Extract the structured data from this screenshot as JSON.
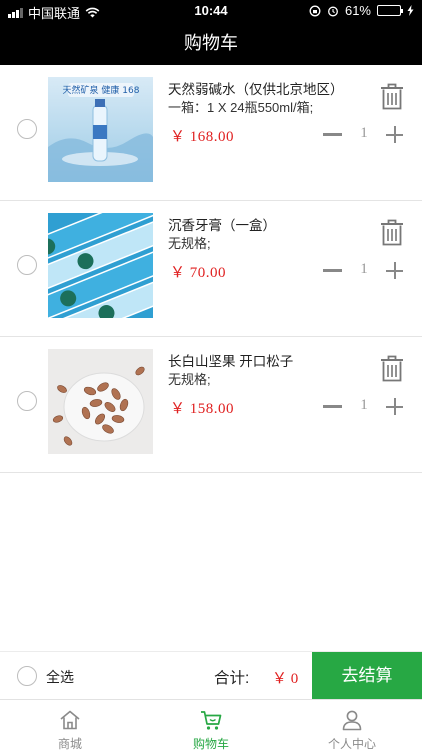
{
  "status_bar": {
    "carrier": "中国联通",
    "time": "10:44",
    "battery": "61%",
    "battery_level": 0.61
  },
  "header": {
    "title": "购物车"
  },
  "cart": {
    "items": [
      {
        "title": "天然弱碱水（仅供北京地区）",
        "spec": "一箱：1 X 24瓶550ml/箱;",
        "price": "￥ 168.00",
        "quantity": "1",
        "image": "bottled-water-product-image",
        "image_text": "天然矿泉 健康 168"
      },
      {
        "title": "沉香牙膏（一盒）",
        "spec": "无规格;",
        "price": "￥ 70.00",
        "quantity": "1",
        "image": "toothpaste-boxes-product-image"
      },
      {
        "title": "长白山坚果 开口松子",
        "spec": "无规格;",
        "price": "￥ 158.00",
        "quantity": "1",
        "image": "pine-nuts-product-image"
      }
    ]
  },
  "footer": {
    "select_all_label": "全选",
    "total_label": "合计:",
    "total_value": "￥ 0",
    "checkout_label": "去结算"
  },
  "tabbar": {
    "tabs": [
      {
        "label": "商城",
        "icon": "home-icon"
      },
      {
        "label": "购物车",
        "icon": "cart-icon",
        "active": true
      },
      {
        "label": "个人中心",
        "icon": "user-icon"
      }
    ]
  },
  "colors": {
    "accent_green": "#27a844",
    "price_red": "#e02020",
    "header_bg": "#000000"
  }
}
